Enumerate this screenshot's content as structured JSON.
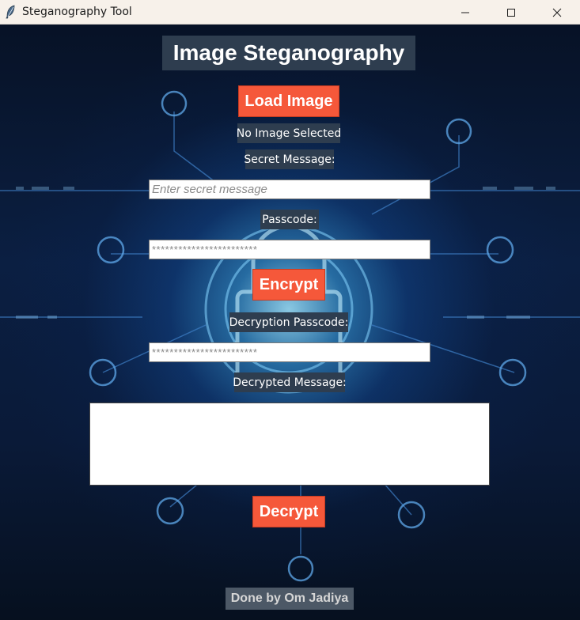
{
  "window": {
    "title": "Steganography Tool",
    "controls": [
      "minimize-icon",
      "maximize-icon",
      "close-icon"
    ]
  },
  "app": {
    "heading": "Image Steganography",
    "load_button": "Load Image",
    "image_status": "No Image Selected",
    "secret_label": "Secret Message:",
    "secret_placeholder": "Enter secret message",
    "passcode_label": "Passcode:",
    "passcode_value": "************************",
    "encrypt_button": "Encrypt",
    "decrypt_passcode_label": "Decryption Passcode:",
    "decrypt_passcode_value": "************************",
    "decrypted_label": "Decrypted Message:",
    "decrypted_value": "",
    "decrypt_button": "Decrypt",
    "footer": "Done by Om Jadiya"
  },
  "colors": {
    "button": "#f5583a",
    "label_bg": "#2e3d4f",
    "footer_bg": "#4c5866"
  }
}
